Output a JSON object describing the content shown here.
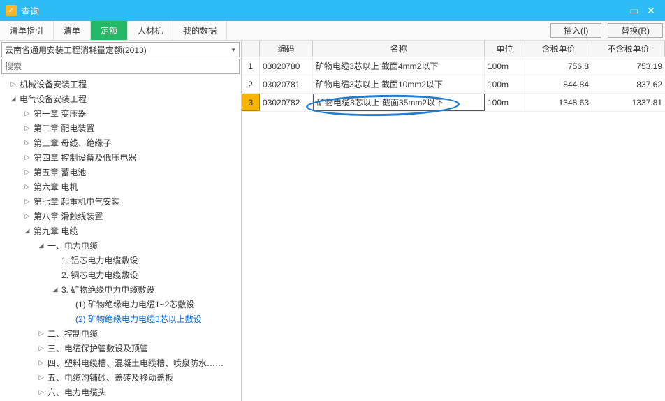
{
  "window": {
    "title": "查询"
  },
  "tabs": [
    "清单指引",
    "清单",
    "定额",
    "人材机",
    "我的数据"
  ],
  "actions": {
    "insert": "插入(I)",
    "replace": "替换(R)"
  },
  "dropdown": "云南省通用安装工程消耗量定额(2013)",
  "search_placeholder": "搜索",
  "tree": {
    "t0": "机械设备安装工程",
    "t1": "电气设备安装工程",
    "c1": "第一章  变压器",
    "c2": "第二章  配电装置",
    "c3": "第三章  母线、绝缘子",
    "c4": "第四章  控制设备及低压电器",
    "c5": "第五章  蓄电池",
    "c6": "第六章  电机",
    "c7": "第七章  起重机电气安装",
    "c8": "第八章  滑触线装置",
    "c9": "第九章  电缆",
    "s1": "一、电力电缆",
    "i1": "1.  铝芯电力电缆敷设",
    "i2": "2.  铜芯电力电缆敷设",
    "i3": "3.  矿物绝缘电力电缆敷设",
    "i31": "(1)  矿物绝缘电力电缆1~2芯敷设",
    "i32": "(2)  矿物绝缘电力电缆3芯以上敷设",
    "s2": "二、控制电缆",
    "s3": "三、电缆保护管敷设及顶管",
    "s4": "四、塑料电缆槽、混凝土电缆槽、喷泉防水……",
    "s5": "五、电缆沟铺砂、盖砖及移动盖板",
    "s6": "六、电力电缆头"
  },
  "grid": {
    "headers": {
      "code": "编码",
      "name": "名称",
      "unit": "单位",
      "p1": "含税单价",
      "p2": "不含税单价"
    },
    "rows": [
      {
        "idx": "1",
        "code": "03020780",
        "name": "矿物电缆3芯以上  截面4mm2以下",
        "unit": "100m",
        "p1": "756.8",
        "p2": "753.19"
      },
      {
        "idx": "2",
        "code": "03020781",
        "name": "矿物电缆3芯以上  截面10mm2以下",
        "unit": "100m",
        "p1": "844.84",
        "p2": "837.62"
      },
      {
        "idx": "3",
        "code": "03020782",
        "name": "矿物电缆3芯以上  截面35mm2以下",
        "unit": "100m",
        "p1": "1348.63",
        "p2": "1337.81"
      }
    ]
  }
}
